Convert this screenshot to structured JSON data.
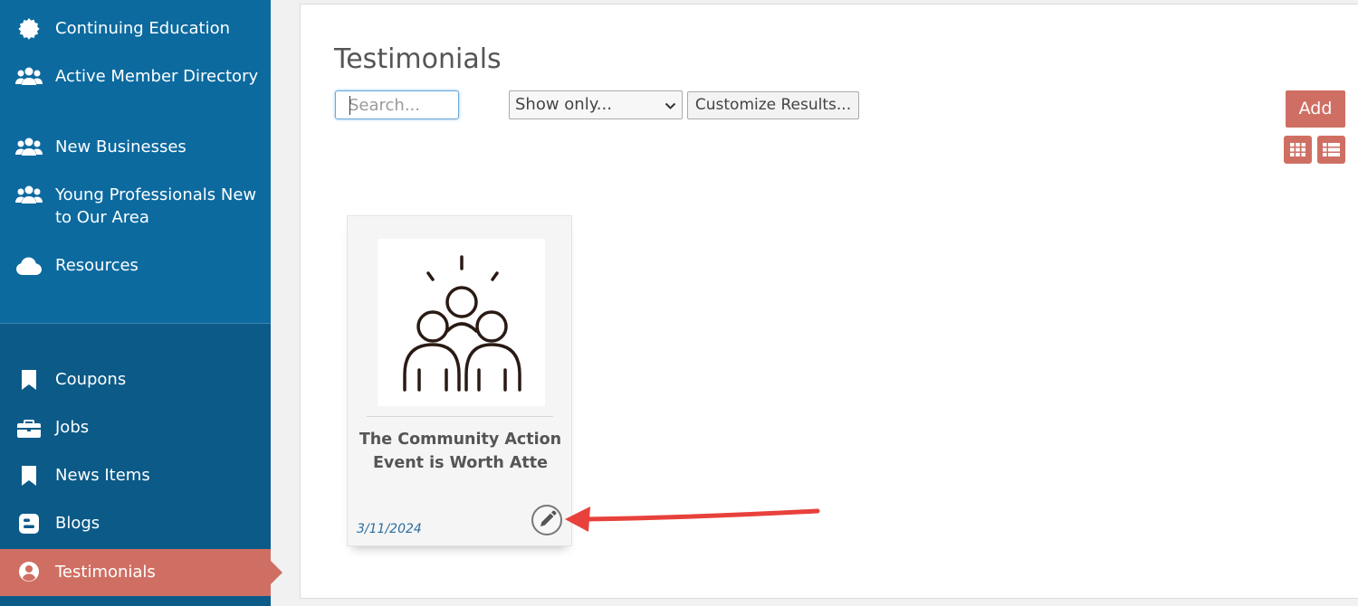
{
  "sidebar": {
    "top_items": [
      {
        "label": "Continuing Education",
        "icon": "badge-icon"
      },
      {
        "label": "Active Member Directory",
        "icon": "users-icon"
      },
      {
        "label": "New Businesses",
        "icon": "users-icon"
      },
      {
        "label": "Young Professionals New to Our Area",
        "icon": "users-icon"
      },
      {
        "label": "Resources",
        "icon": "cloud-icon"
      }
    ],
    "bottom_items": [
      {
        "label": "Coupons",
        "icon": "bookmark-icon"
      },
      {
        "label": "Jobs",
        "icon": "briefcase-icon"
      },
      {
        "label": "News Items",
        "icon": "bookmark-icon"
      },
      {
        "label": "Blogs",
        "icon": "blogger-icon"
      },
      {
        "label": "Testimonials",
        "icon": "user-circle-icon",
        "active": true
      }
    ]
  },
  "main": {
    "title": "Testimonials",
    "search_placeholder": "Search...",
    "show_only": "Show only...",
    "customize_label": "Customize Results...",
    "add_label": "Add",
    "view_buttons": [
      "grid-view-icon",
      "list-view-icon"
    ]
  },
  "card": {
    "title": "The Community Action Event is Worth Atte",
    "date": "3/11/2024",
    "image_icon": "community-group-icon",
    "edit_icon": "pencil-icon"
  },
  "colors": {
    "sidebar_top": "#0c6a9f",
    "sidebar_bottom": "#0b5a88",
    "accent": "#cf6f63",
    "date_text": "#2d6e9e",
    "annotation_arrow": "#e8413c"
  }
}
